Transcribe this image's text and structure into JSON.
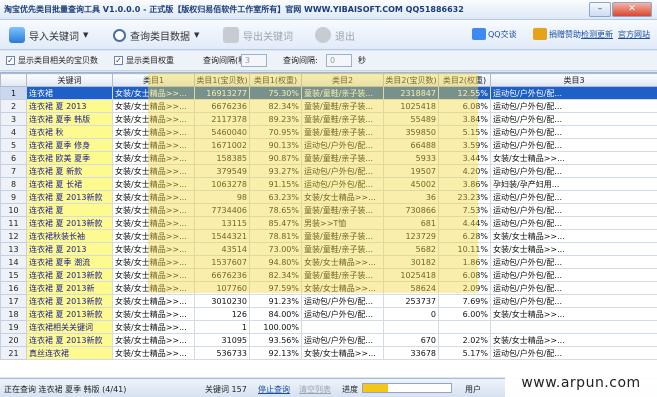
{
  "window": {
    "title": "淘宝优先类目批量查询工具 V1.0.0.0 - 正式版【版权归易佰软件工作室所有】官网 WWW.YIBAISOFT.COM QQ51886632"
  },
  "toolbar": {
    "import_label": "导入关键词",
    "query_label": "查询类目数据",
    "export_label": "导出关键词",
    "exit_label": "退出",
    "qq_label": "QQ交谈",
    "donate_label": "捐赠赞助",
    "update_label": "检测更新",
    "site_label": "官方网站"
  },
  "options": {
    "show_related": "显示类目相关的宝贝数",
    "show_weight": "显示类目权重",
    "count_label": "查询间隔(秒):",
    "count_value": "3",
    "interval_label": "查询间隔:",
    "interval_value": "0",
    "interval_unit": "秒"
  },
  "table": {
    "columns": [
      "",
      "关键词",
      "类目1",
      "类目1(宝贝数)",
      "类目1(权重)",
      "类目2",
      "类目2(宝贝数)",
      "类目2(权重)",
      "类目3"
    ],
    "rows": [
      [
        "1",
        "连衣裙",
        "女装/女士精品>>...",
        "16913277",
        "75.30%",
        "童装/童鞋/亲子装...",
        "2318847",
        "12.55%",
        "运动包/户外包/配..."
      ],
      [
        "2",
        "连衣裙 夏 2013",
        "女装/女士精品>>...",
        "6676236",
        "82.34%",
        "童装/童鞋/亲子装...",
        "1025418",
        "6.08%",
        "运动包/户外包/配..."
      ],
      [
        "3",
        "连衣裙 夏季 韩版",
        "女装/女士精品>>...",
        "2117378",
        "89.23%",
        "童装/童鞋/亲子装...",
        "55489",
        "3.84%",
        "运动包/户外包/配..."
      ],
      [
        "4",
        "连衣裙 秋",
        "女装/女士精品>>...",
        "5460040",
        "70.95%",
        "童装/童鞋/亲子装...",
        "359850",
        "5.15%",
        "运动包/户外包/配..."
      ],
      [
        "5",
        "连衣裙 夏季 修身",
        "女装/女士精品>>...",
        "1671002",
        "90.13%",
        "运动包/户外包/配...",
        "66488",
        "3.59%",
        "运动包/户外包/配..."
      ],
      [
        "6",
        "连衣裙 欧美 夏季",
        "女装/女士精品>>...",
        "158385",
        "90.87%",
        "童装/童鞋/亲子装...",
        "5933",
        "3.44%",
        "女装/女士精品>>..."
      ],
      [
        "7",
        "连衣裙 夏 新款",
        "女装/女士精品>>...",
        "379549",
        "93.27%",
        "运动包/户外包/配...",
        "19507",
        "4.20%",
        "运动包/户外包/配..."
      ],
      [
        "8",
        "连衣裙 夏 长裙",
        "女装/女士精品>>...",
        "1063278",
        "91.15%",
        "运动包/户外包/配...",
        "45002",
        "3.86%",
        "孕妇装/孕产妇用..."
      ],
      [
        "9",
        "连衣裙 夏 2013新款",
        "女装/女士精品>>...",
        "98",
        "63.23%",
        "女装/女士精品>>...",
        "36",
        "23.23%",
        "运动包/户外包/配..."
      ],
      [
        "10",
        "连衣裙 夏",
        "女装/女士精品>>...",
        "7734406",
        "78.65%",
        "童装/童鞋/亲子装...",
        "730866",
        "7.53%",
        "运动包/户外包/配..."
      ],
      [
        "11",
        "连衣裙 夏 2013新款",
        "女装/女士精品>>...",
        "13115",
        "85.47%",
        "男装>>T恤",
        "681",
        "4.44%",
        "运动包/户外包/配..."
      ],
      [
        "12",
        "连衣裙秋装长袖",
        "女装/女士精品>>...",
        "1544321",
        "78.81%",
        "童装/童鞋/亲子装...",
        "123729",
        "6.28%",
        "女装/女士精品>>..."
      ],
      [
        "13",
        "连衣裙 夏 2013",
        "女装/女士精品>>...",
        "43514",
        "73.00%",
        "童装/童鞋/亲子装...",
        "5682",
        "10.11%",
        "女装/女士精品>>..."
      ],
      [
        "14",
        "连衣裙 夏季 潮流",
        "女装/女士精品>>...",
        "1537607",
        "94.80%",
        "女装/女士精品>>...",
        "30182",
        "1.86%",
        "运动包/户外包/配..."
      ],
      [
        "15",
        "连衣裙 夏 2013新款",
        "女装/女士精品>>...",
        "6676236",
        "82.34%",
        "童装/童鞋/亲子装...",
        "1025418",
        "6.08%",
        "运动包/户外包/配..."
      ],
      [
        "16",
        "连衣裙 夏 2013新",
        "女装/女士精品>>...",
        "107760",
        "97.59%",
        "女装/女士精品>>...",
        "58624",
        "2.09%",
        "运动包/户外包/配..."
      ],
      [
        "17",
        "连衣裙 夏 2013新款",
        "女装/女士精品>>...",
        "3010230",
        "91.23%",
        "运动包/户外包/配...",
        "253737",
        "7.69%",
        "运动包/户外包/配..."
      ],
      [
        "18",
        "连衣裙 夏 2013新款",
        "女装/女士精品>>...",
        "126",
        "84.00%",
        "运动包/户外包/配...",
        "0",
        "6.00%",
        "女装/女士精品>>..."
      ],
      [
        "19",
        "连衣裙相关关键词",
        "女装/女士精品>>...",
        "1",
        "100.00%",
        "",
        "",
        "",
        ""
      ],
      [
        "20",
        "连衣裙 夏 2013新款",
        "女装/女士精品>>...",
        "31095",
        "93.56%",
        "运动包/户外包/配...",
        "670",
        "2.02%",
        "女装/女士精品>>..."
      ],
      [
        "21",
        "真丝连衣裙",
        "女装/女士精品>>...",
        "536733",
        "92.13%",
        "女装/女士精品>>...",
        "33678",
        "5.17%",
        "运动包/户外包/配..."
      ]
    ]
  },
  "status": {
    "left_text": "正在查询 连衣裙 夏季 韩版 (4/41)",
    "keywords_label": "关键词 157",
    "stop_label": "停止查询",
    "clear_label": "清空列表",
    "progress_label": "进度",
    "progress_fraction": 0.28,
    "user_label": "用户"
  },
  "site_watermark": "www.arpun.com",
  "colors": {
    "keyword_highlight": "#fdfb8f",
    "selected_row": "#1f5fc8",
    "promo_overlay": "#f2d63c"
  }
}
